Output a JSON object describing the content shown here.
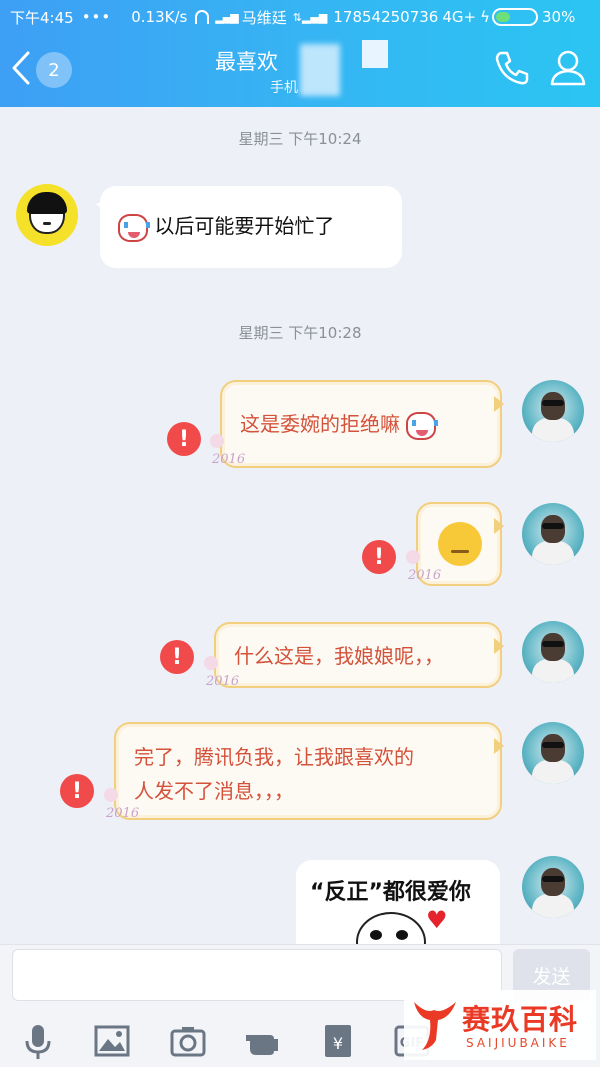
{
  "status_bar": {
    "time": "下午4:45",
    "dots": "•••",
    "speed": "0.13K/s",
    "carrier": "马维廷",
    "phone_number": "17854250736",
    "network": "4G+",
    "battery": "30%"
  },
  "header": {
    "unread_count": "2",
    "title": "最喜欢",
    "subtitle": "手机"
  },
  "messages": {
    "ts1": "星期三 下午10:24",
    "friend_msg": "以后可能要开始忙了",
    "ts2": "星期三 下午10:28",
    "self_msg1": "这是委婉的拒绝嘛",
    "self_msg3": "什么这是，我娘娘呢，，",
    "self_msg4_line1": "完了，腾讯负我，让我跟喜欢的",
    "self_msg4_line2": "人发不了消息，，，",
    "sticker_text": "“反正”都很爱你",
    "bubble_deco": "2016",
    "error_mark": "!"
  },
  "input_bar": {
    "send_label": "发送"
  },
  "watermark": {
    "title": "赛玖百科",
    "subtitle": "SAIJIUBAIKE"
  },
  "colors": {
    "header_start": "#3e9ff4",
    "header_end": "#2bc5f2",
    "error_red": "#f04a4a",
    "self_text": "#d4513a",
    "bubble_border": "#f1cf7e"
  }
}
